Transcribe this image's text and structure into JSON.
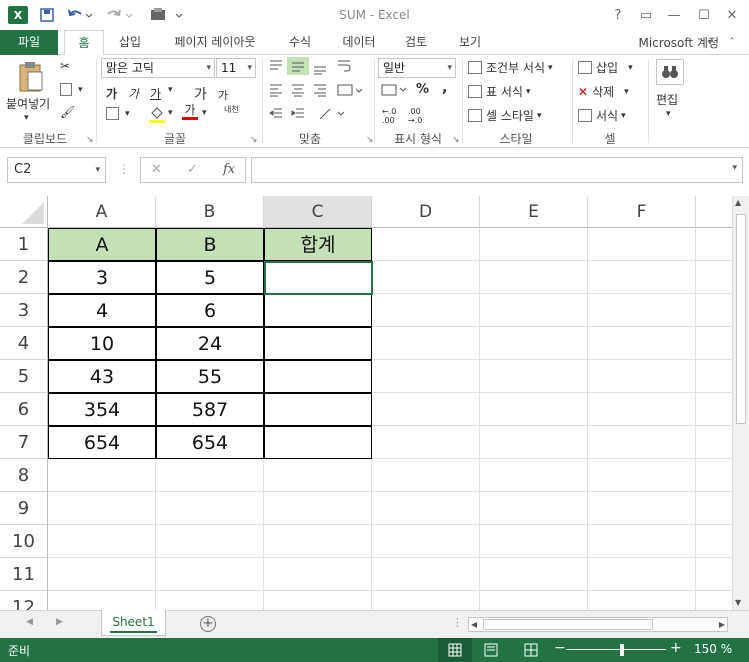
{
  "window": {
    "app_logo": "X",
    "title": "SUM - Excel",
    "help": "?",
    "restore_ribbon": "▭",
    "minimize": "—",
    "maximize": "☐",
    "close": "✕"
  },
  "qat": {
    "save_icon": "save-icon",
    "undo_icon": "undo-icon",
    "redo_icon": "redo-icon",
    "custom_icon": "customize-icon"
  },
  "tabs": {
    "file": "파일",
    "home": "홈",
    "insert": "삽입",
    "page_layout": "페이지 레이아웃",
    "formulas": "수식",
    "data": "데이터",
    "review": "검토",
    "view": "보기"
  },
  "account": "Microsoft 계정",
  "ribbon": {
    "clipboard": {
      "paste": "붙여넣기",
      "label": "클립보드"
    },
    "font": {
      "name": "맑은 고딕",
      "size": "11",
      "bold": "가",
      "italic": "가",
      "underline": "가",
      "grow": "가",
      "shrink": "가",
      "phonetic": "내천",
      "font_color": "가",
      "label": "글꼴"
    },
    "alignment": {
      "label": "맞춤"
    },
    "number": {
      "format": "일반",
      "percent": "%",
      "comma": ",",
      "label": "표시 형식"
    },
    "styles": {
      "conditional": "조건부 서식",
      "table": "표 서식",
      "cell_styles": "셀 스타일",
      "label": "스타일"
    },
    "cells": {
      "insert": "삽입",
      "delete": "삭제",
      "format": "서식",
      "label": "셀"
    },
    "editing": {
      "label": "편집"
    }
  },
  "formula_bar": {
    "name_box": "C2",
    "cancel": "✕",
    "enter": "✓",
    "fx": "fx",
    "value": ""
  },
  "grid": {
    "columns": [
      "A",
      "B",
      "C",
      "D",
      "E",
      "F"
    ],
    "rows": [
      "1",
      "2",
      "3",
      "4",
      "5",
      "6",
      "7",
      "8",
      "9",
      "10",
      "11",
      "12"
    ],
    "header_row": [
      "A",
      "B",
      "합계"
    ],
    "data_rows": [
      [
        "3",
        "5",
        ""
      ],
      [
        "4",
        "6",
        ""
      ],
      [
        "10",
        "24",
        ""
      ],
      [
        "43",
        "55",
        ""
      ],
      [
        "354",
        "587",
        ""
      ],
      [
        "654",
        "654",
        ""
      ]
    ],
    "header_fill": "#c5e0b4"
  },
  "sheets": {
    "active": "Sheet1",
    "add": "+"
  },
  "status": {
    "ready": "준비",
    "zoom": "150 %",
    "zoom_minus": "−",
    "zoom_plus": "+"
  },
  "colors": {
    "accent": "#217346"
  }
}
